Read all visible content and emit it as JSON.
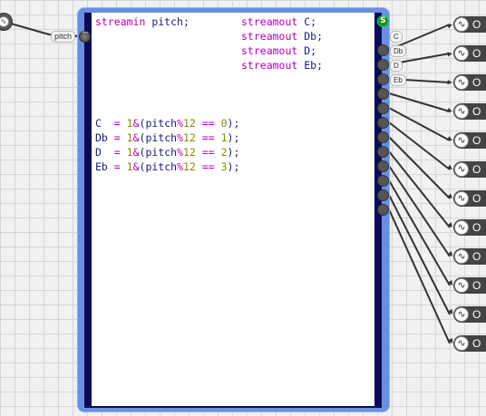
{
  "code": {
    "decl_in": "streamin pitch;",
    "decl_out": [
      "streamout C;",
      "streamout Db;",
      "streamout D;",
      "streamout Eb;"
    ],
    "assignments": [
      {
        "var": "C ",
        "mod": "12",
        "val": "0"
      },
      {
        "var": "Db",
        "mod": "12",
        "val": "1"
      },
      {
        "var": "D ",
        "mod": "12",
        "val": "2"
      },
      {
        "var": "Eb",
        "mod": "12",
        "val": "3"
      }
    ]
  },
  "ports": {
    "input_label": "pitch",
    "start_glyph": "S",
    "output_labels": [
      "C",
      "Db",
      "D",
      "Eb"
    ]
  },
  "out_nodes": {
    "label": "O",
    "count": 12
  },
  "icons": {
    "wave": "∿"
  }
}
